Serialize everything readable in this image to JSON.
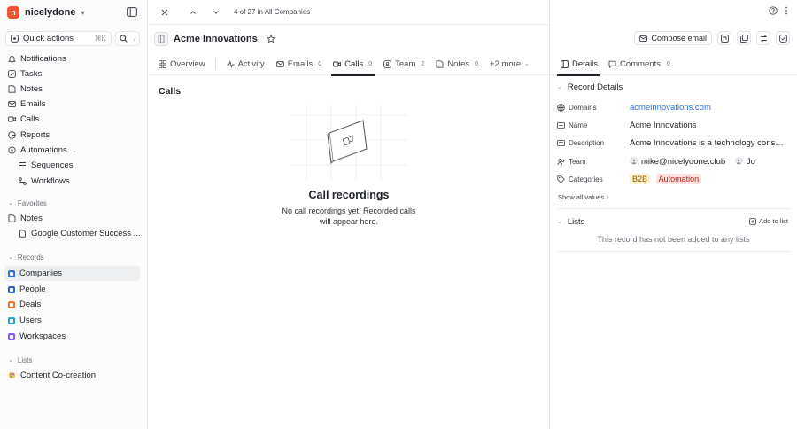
{
  "workspace": {
    "name": "nicelydone",
    "logo_letter": "n"
  },
  "quick_actions": {
    "label": "Quick actions",
    "shortcut": "⌘K",
    "search_shortcut": "/"
  },
  "nav": {
    "items": [
      {
        "label": "Notifications"
      },
      {
        "label": "Tasks"
      },
      {
        "label": "Notes"
      },
      {
        "label": "Emails"
      },
      {
        "label": "Calls"
      },
      {
        "label": "Reports"
      },
      {
        "label": "Automations"
      }
    ],
    "automations_sub": [
      {
        "label": "Sequences"
      },
      {
        "label": "Workflows"
      }
    ]
  },
  "favorites": {
    "label": "Favorites",
    "notes_label": "Notes",
    "sub_item": "Google Customer Success ..."
  },
  "records": {
    "label": "Records",
    "items": [
      {
        "label": "Companies",
        "color": "#3b6fd8"
      },
      {
        "label": "People",
        "color": "#2f5fd0"
      },
      {
        "label": "Deals",
        "color": "#f07a2b"
      },
      {
        "label": "Users",
        "color": "#2aa3c9"
      },
      {
        "label": "Workspaces",
        "color": "#8b5cf6"
      }
    ]
  },
  "lists_nav": {
    "label": "Lists",
    "items": [
      {
        "label": "Content Co-creation"
      }
    ]
  },
  "topbar": {
    "breadcrumb": "4 of 27 in All Companies"
  },
  "record": {
    "title": "Acme Innovations"
  },
  "actions": {
    "compose_email": "Compose email"
  },
  "tabs": [
    {
      "label": "Overview",
      "count": ""
    },
    {
      "label": "Activity",
      "count": ""
    },
    {
      "label": "Emails",
      "count": "0"
    },
    {
      "label": "Calls",
      "count": "0"
    },
    {
      "label": "Team",
      "count": "2"
    },
    {
      "label": "Notes",
      "count": "0"
    },
    {
      "label": "+2 more",
      "count": ""
    }
  ],
  "calls_section": {
    "title": "Calls",
    "empty_title": "Call recordings",
    "empty_desc": "No call recordings yet! Recorded calls will appear here."
  },
  "right_tabs": [
    {
      "label": "Details",
      "count": ""
    },
    {
      "label": "Comments",
      "count": "0"
    }
  ],
  "details": {
    "group_title": "Record Details",
    "fields": {
      "domains": {
        "label": "Domains",
        "value": "acmeinnovations.com"
      },
      "name": {
        "label": "Name",
        "value": "Acme Innovations"
      },
      "description": {
        "label": "Description",
        "value": "Acme Innovations is a technology consultancy"
      },
      "team": {
        "label": "Team",
        "members": [
          "mike@nicelydone.club",
          "Jo"
        ]
      },
      "categories": {
        "label": "Categories",
        "tags": [
          {
            "label": "B2B",
            "bg": "#fdf0c7",
            "fg": "#8a5a00"
          },
          {
            "label": "Automation",
            "bg": "#fde2e1",
            "fg": "#b42318"
          }
        ]
      }
    },
    "show_all": "Show all values"
  },
  "lists_panel": {
    "title": "Lists",
    "add_label": "Add to list",
    "empty": "This record has not been added to any lists"
  }
}
